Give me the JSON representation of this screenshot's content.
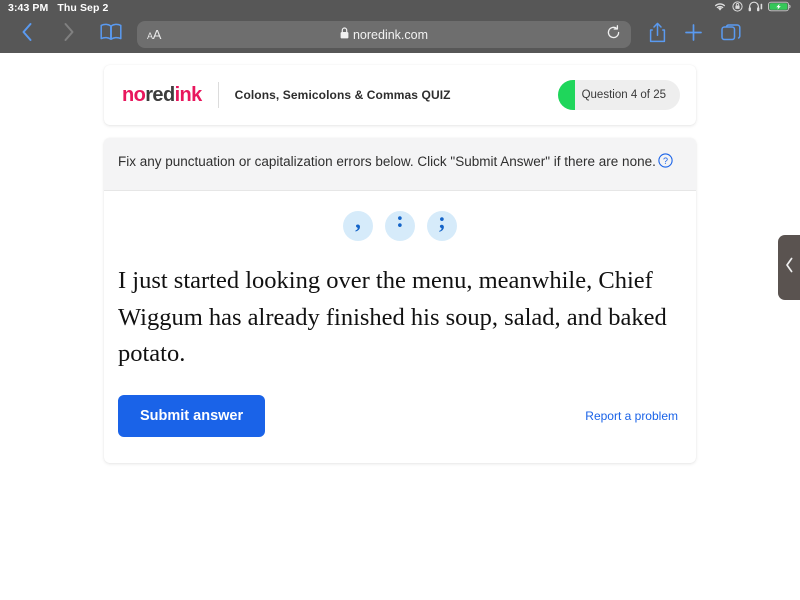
{
  "status_bar": {
    "time": "3:43 PM",
    "date": "Thu Sep 2",
    "icons": [
      "wifi-icon",
      "rotation-lock-icon",
      "headphones-icon",
      "battery-charging-icon"
    ],
    "battery_color": "#35c759"
  },
  "browser": {
    "back_icon": "chevron-left-icon",
    "forward_icon": "chevron-right-icon",
    "bookmarks_icon": "book-icon",
    "text_size_label_small": "A",
    "text_size_label_large": "A",
    "lock_icon": "lock-icon",
    "url": "noredink.com",
    "reload_icon": "reload-icon",
    "share_icon": "share-icon",
    "new_tab_icon": "plus-icon",
    "tabs_icon": "tabs-icon",
    "chrome_color": "#575757"
  },
  "header": {
    "logo_part1": "no",
    "logo_part2": "red",
    "logo_part3": "ink",
    "logo_pink": "#e8175d",
    "logo_dark": "#3d3d3d",
    "quiz_title": "Colons, Semicolons & Commas QUIZ",
    "question_badge": "Question 4 of 25",
    "progress_color": "#1fd65b"
  },
  "instructions": {
    "text": "Fix any punctuation or capitalization errors below. Click \"Submit Answer\" if there are none.",
    "help_icon": "help-circle-icon"
  },
  "punctuation_buttons": [
    {
      "name": "comma-button",
      "glyph": ","
    },
    {
      "name": "colon-button",
      "glyph": ":"
    },
    {
      "name": "semicolon-button",
      "glyph": ";"
    }
  ],
  "question": {
    "sentence": "I just started looking over the menu, meanwhile, Chief Wiggum has already finished his soup, salad, and baked potato."
  },
  "actions": {
    "submit_label": "Submit answer",
    "submit_color": "#1a63e8",
    "report_label": "Report a problem",
    "report_color": "#1a63e8"
  },
  "edge_tab": {
    "icon": "chevron-left-icon",
    "color": "#5a5350"
  }
}
